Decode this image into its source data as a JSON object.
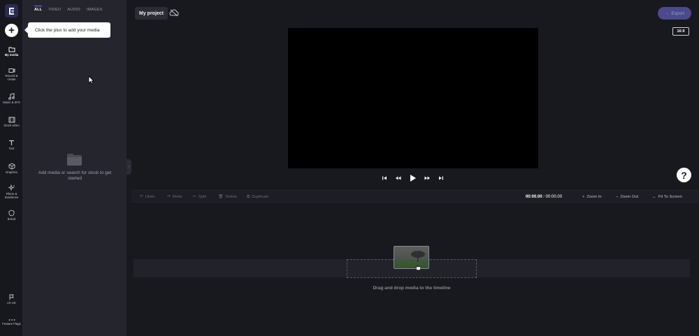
{
  "sidebar": {
    "items": [
      {
        "label": "My media",
        "icon": "folder-icon",
        "active": true
      },
      {
        "label": "Record & create",
        "icon": "video-camera-icon"
      },
      {
        "label": "Music & SFX",
        "icon": "music-note-icon"
      },
      {
        "label": "Stock video",
        "icon": "film-icon"
      },
      {
        "label": "Text",
        "icon": "text-icon"
      },
      {
        "label": "Graphics",
        "icon": "cube-icon"
      },
      {
        "label": "Filters & transitions",
        "icon": "sparkle-icon"
      },
      {
        "label": "Brand",
        "icon": "shield-icon"
      }
    ],
    "bottom_items": [
      {
        "label": "en-US",
        "icon": "flag-icon"
      },
      {
        "label": "Feature Flags",
        "icon": "more-dots-icon"
      }
    ]
  },
  "tooltip": {
    "text": "Click the plus to add your media"
  },
  "media_panel": {
    "tabs": [
      "ALL",
      "VIDEO",
      "AUDIO",
      "IMAGES"
    ],
    "active_tab": "ALL",
    "empty_text": "Add media or search for stock to get started"
  },
  "header": {
    "project_name": "My project",
    "export_label": "Export",
    "aspect_ratio": "16:9"
  },
  "toolbar": {
    "undo": "Undo",
    "redo": "Redo",
    "split": "Split",
    "delete": "Delete",
    "duplicate": "Duplicate",
    "time_current": "00:00.00",
    "time_separator": "/",
    "time_total": "00:00.00",
    "zoom_in": "Zoom In",
    "zoom_out": "Zoom Out",
    "fit": "Fit To Screen"
  },
  "timeline": {
    "drop_text": "Drag and drop media to the timeline"
  },
  "help": {
    "label": "?"
  },
  "colors": {
    "accent": "#7a6ff0",
    "export_button": "#4b4a8c",
    "panel_bg": "#25252e",
    "app_bg": "#18181f"
  }
}
